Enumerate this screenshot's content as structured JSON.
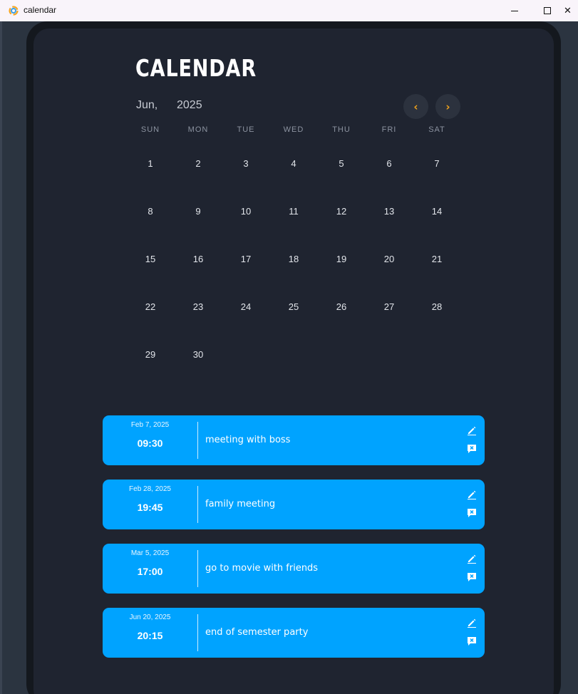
{
  "window": {
    "title": "calendar",
    "close_glyph": "✕"
  },
  "calendar": {
    "title": "CALENDAR",
    "month": "Jun,",
    "year": "2025",
    "prev_glyph": "‹",
    "next_glyph": "›",
    "weekdays": [
      "SUN",
      "MON",
      "TUE",
      "WED",
      "THU",
      "FRI",
      "SAT"
    ],
    "days": [
      "1",
      "2",
      "3",
      "4",
      "5",
      "6",
      "7",
      "8",
      "9",
      "10",
      "11",
      "12",
      "13",
      "14",
      "15",
      "16",
      "17",
      "18",
      "19",
      "20",
      "21",
      "22",
      "23",
      "24",
      "25",
      "26",
      "27",
      "28",
      "29",
      "30"
    ],
    "accent_color": "#f0a21b"
  },
  "events": [
    {
      "date": "Feb 7, 2025",
      "time": "09:30",
      "text": "meeting with boss"
    },
    {
      "date": "Feb 28, 2025",
      "time": "19:45",
      "text": "family meeting"
    },
    {
      "date": "Mar 5, 2025",
      "time": "17:00",
      "text": "go to movie with friends"
    },
    {
      "date": "Jun 20, 2025",
      "time": "20:15",
      "text": "end of semester party"
    }
  ],
  "colors": {
    "event_bg": "#00a3ff",
    "screen_bg": "#1f2430"
  },
  "icons": {
    "edit": "pencil-icon",
    "delete": "delete-message-icon"
  }
}
